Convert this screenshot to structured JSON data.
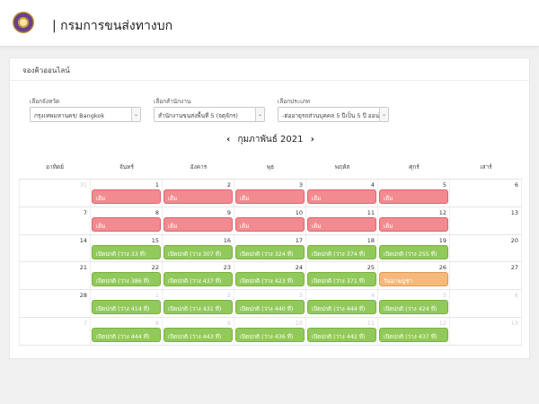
{
  "header": {
    "title": "| กรมการขนส่งทางบก"
  },
  "card": {
    "title": "จองคิวออนไลน์"
  },
  "filters": {
    "province": {
      "label": "เลือกจังหวัด",
      "value": "กรุงเทพมหานคร/ Bangkok"
    },
    "office": {
      "label": "เลือกสำนักงาน",
      "value": "สำนักงานขนส่งพื้นที่ 5 (จตุจักร)"
    },
    "category": {
      "label": "เลือกประเภท",
      "value": "-ต่ออายุรถส่วนบุคคล 5 ปีเป็น 5 ปี ออนไลน์"
    }
  },
  "calendar": {
    "month_label": "กุมภาพันธ์ 2021",
    "prev_icon": "‹",
    "next_icon": "›",
    "weekdays": [
      "อาทิตย์",
      "จันทร์",
      "อังคาร",
      "พุธ",
      "พฤหัส",
      "ศุกร์",
      "เสาร์"
    ],
    "weeks": [
      [
        {
          "day": "31",
          "other": true
        },
        {
          "day": "1",
          "event": "เต็ม",
          "status": "full"
        },
        {
          "day": "2",
          "event": "เต็ม",
          "status": "full"
        },
        {
          "day": "3",
          "event": "เต็ม",
          "status": "full"
        },
        {
          "day": "4",
          "event": "เต็ม",
          "status": "full"
        },
        {
          "day": "5",
          "event": "เต็ม",
          "status": "full"
        },
        {
          "day": "6"
        }
      ],
      [
        {
          "day": "7"
        },
        {
          "day": "8",
          "event": "เต็ม",
          "status": "full"
        },
        {
          "day": "9",
          "event": "เต็ม",
          "status": "full"
        },
        {
          "day": "10",
          "event": "เต็ม",
          "status": "full"
        },
        {
          "day": "11",
          "event": "เต็ม",
          "status": "full"
        },
        {
          "day": "12",
          "event": "เต็ม",
          "status": "full"
        },
        {
          "day": "13"
        }
      ],
      [
        {
          "day": "14"
        },
        {
          "day": "15",
          "event": "เปิดปกติ (ว่าง 33 ที่)",
          "status": "open"
        },
        {
          "day": "16",
          "event": "เปิดปกติ (ว่าง 307 ที่)",
          "status": "open"
        },
        {
          "day": "17",
          "event": "เปิดปกติ (ว่าง 324 ที่)",
          "status": "open"
        },
        {
          "day": "18",
          "event": "เปิดปกติ (ว่าง 374 ที่)",
          "status": "open"
        },
        {
          "day": "19",
          "event": "เปิดปกติ (ว่าง 255 ที่)",
          "status": "open"
        },
        {
          "day": "20"
        }
      ],
      [
        {
          "day": "21"
        },
        {
          "day": "22",
          "event": "เปิดปกติ (ว่าง 386 ที่)",
          "status": "open"
        },
        {
          "day": "23",
          "event": "เปิดปกติ (ว่าง 437 ที่)",
          "status": "open"
        },
        {
          "day": "24",
          "event": "เปิดปกติ (ว่าง 423 ที่)",
          "status": "open"
        },
        {
          "day": "25",
          "event": "เปิดปกติ (ว่าง 371 ที่)",
          "status": "open"
        },
        {
          "day": "26",
          "event": "วันมาฆบูชา",
          "status": "holiday"
        },
        {
          "day": "27"
        }
      ],
      [
        {
          "day": "28"
        },
        {
          "day": "1",
          "other": true,
          "event": "เปิดปกติ (ว่าง 414 ที่)",
          "status": "open"
        },
        {
          "day": "2",
          "other": true,
          "event": "เปิดปกติ (ว่าง 431 ที่)",
          "status": "open"
        },
        {
          "day": "3",
          "other": true,
          "event": "เปิดปกติ (ว่าง 440 ที่)",
          "status": "open"
        },
        {
          "day": "4",
          "other": true,
          "event": "เปิดปกติ (ว่าง 444 ที่)",
          "status": "open"
        },
        {
          "day": "5",
          "other": true,
          "event": "เปิดปกติ (ว่าง 424 ที่)",
          "status": "open"
        },
        {
          "day": "6",
          "other": true
        }
      ],
      [
        {
          "day": "7",
          "other": true
        },
        {
          "day": "8",
          "other": true,
          "event": "เปิดปกติ (ว่าง 444 ที่)",
          "status": "open"
        },
        {
          "day": "9",
          "other": true,
          "event": "เปิดปกติ (ว่าง 443 ที่)",
          "status": "open"
        },
        {
          "day": "10",
          "other": true,
          "event": "เปิดปกติ (ว่าง 436 ที่)",
          "status": "open"
        },
        {
          "day": "11",
          "other": true,
          "event": "เปิดปกติ (ว่าง 442 ที่)",
          "status": "open"
        },
        {
          "day": "12",
          "other": true,
          "event": "เปิดปกติ (ว่าง 437 ที่)",
          "status": "open"
        },
        {
          "day": "13",
          "other": true
        }
      ]
    ]
  },
  "colors": {
    "full": "#f28b8f",
    "open": "#92c95c",
    "holiday": "#f6b97c"
  }
}
